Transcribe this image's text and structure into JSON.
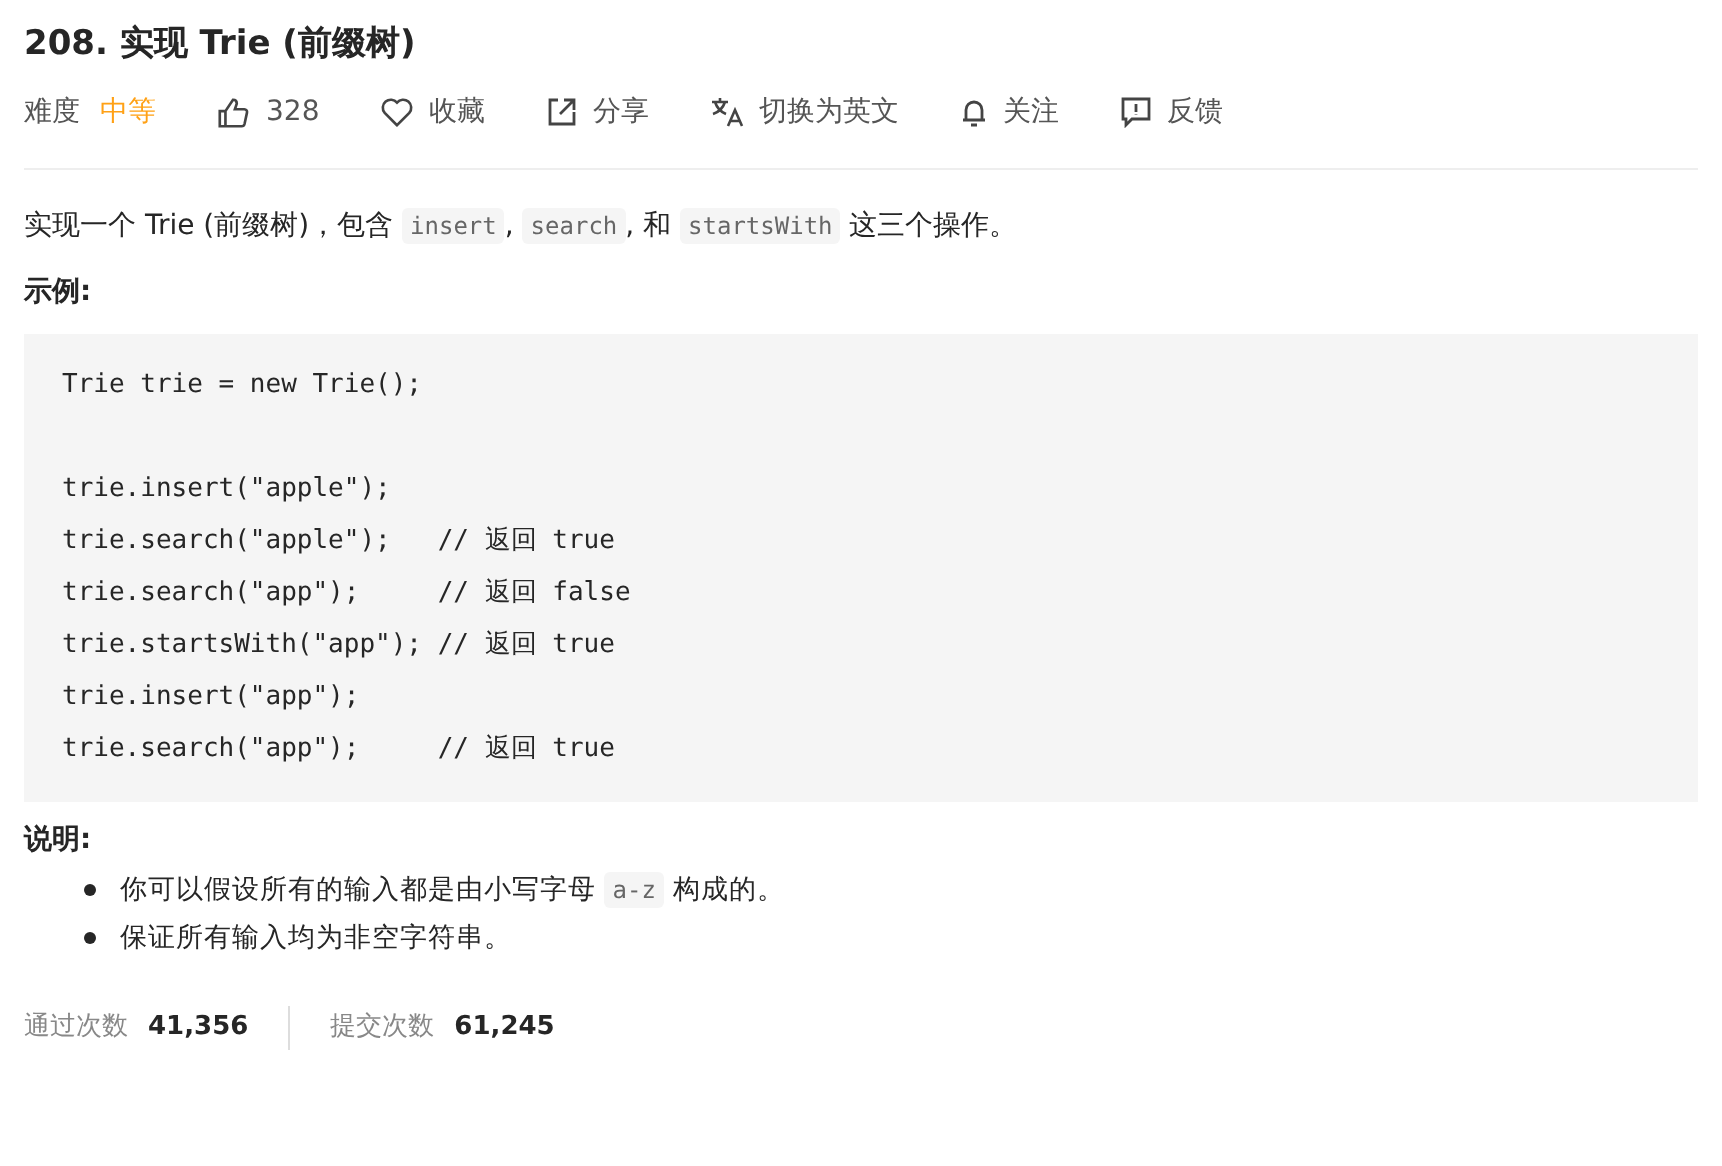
{
  "title": "208. 实现 Trie (前缀树)",
  "meta": {
    "difficulty_label": "难度",
    "difficulty": "中等",
    "actions": [
      {
        "kind": "like",
        "label": "328"
      },
      {
        "kind": "heart",
        "label": "收藏"
      },
      {
        "kind": "share",
        "label": "分享"
      },
      {
        "kind": "translate",
        "label": "切换为英文"
      },
      {
        "kind": "bell",
        "label": "关注"
      },
      {
        "kind": "feedback",
        "label": "反馈"
      }
    ]
  },
  "description": [
    {
      "kind": "text",
      "text": "实现一个 Trie (前缀树)，包含 "
    },
    {
      "kind": "code",
      "text": "insert"
    },
    {
      "kind": "text",
      "text": ", "
    },
    {
      "kind": "code",
      "text": "search"
    },
    {
      "kind": "text",
      "text": ", 和 "
    },
    {
      "kind": "code",
      "text": "startsWith"
    },
    {
      "kind": "text",
      "text": " 这三个操作。"
    }
  ],
  "example_heading": "示例:",
  "example_code": "Trie trie = new Trie();\n\ntrie.insert(\"apple\");\ntrie.search(\"apple\");   // 返回 true\ntrie.search(\"app\");     // 返回 false\ntrie.startsWith(\"app\"); // 返回 true\ntrie.insert(\"app\");\ntrie.search(\"app\");     // 返回 true",
  "notes_heading": "说明:",
  "notes": [
    [
      {
        "kind": "text",
        "text": "你可以假设所有的输入都是由小写字母 "
      },
      {
        "kind": "code",
        "text": "a-z"
      },
      {
        "kind": "text",
        "text": " 构成的。"
      }
    ],
    [
      {
        "kind": "text",
        "text": "保证所有输入均为非空字符串。"
      }
    ]
  ],
  "stats": [
    {
      "label": "通过次数",
      "value": "41,356"
    },
    {
      "label": "提交次数",
      "value": "61,245"
    }
  ]
}
